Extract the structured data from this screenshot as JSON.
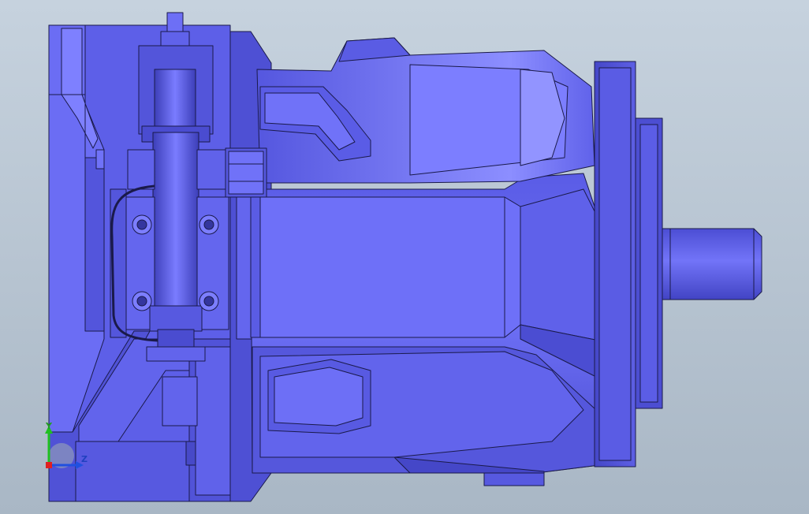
{
  "viewport": {
    "background_top": "#c4d0dc",
    "background_bottom": "#a8b6c4"
  },
  "model": {
    "name": "hydraulic-axial-piston-pump",
    "face_color": "#6a6cf2",
    "face_dark": "#4b4dcc",
    "face_darker": "#3a3cb0",
    "face_light": "#8a8cff",
    "edge_color": "#1a1a4a"
  },
  "triad": {
    "y_label": "Y",
    "z_label": "Z",
    "x_color": "#e02020",
    "y_color": "#20c020",
    "z_color": "#2050e0"
  }
}
